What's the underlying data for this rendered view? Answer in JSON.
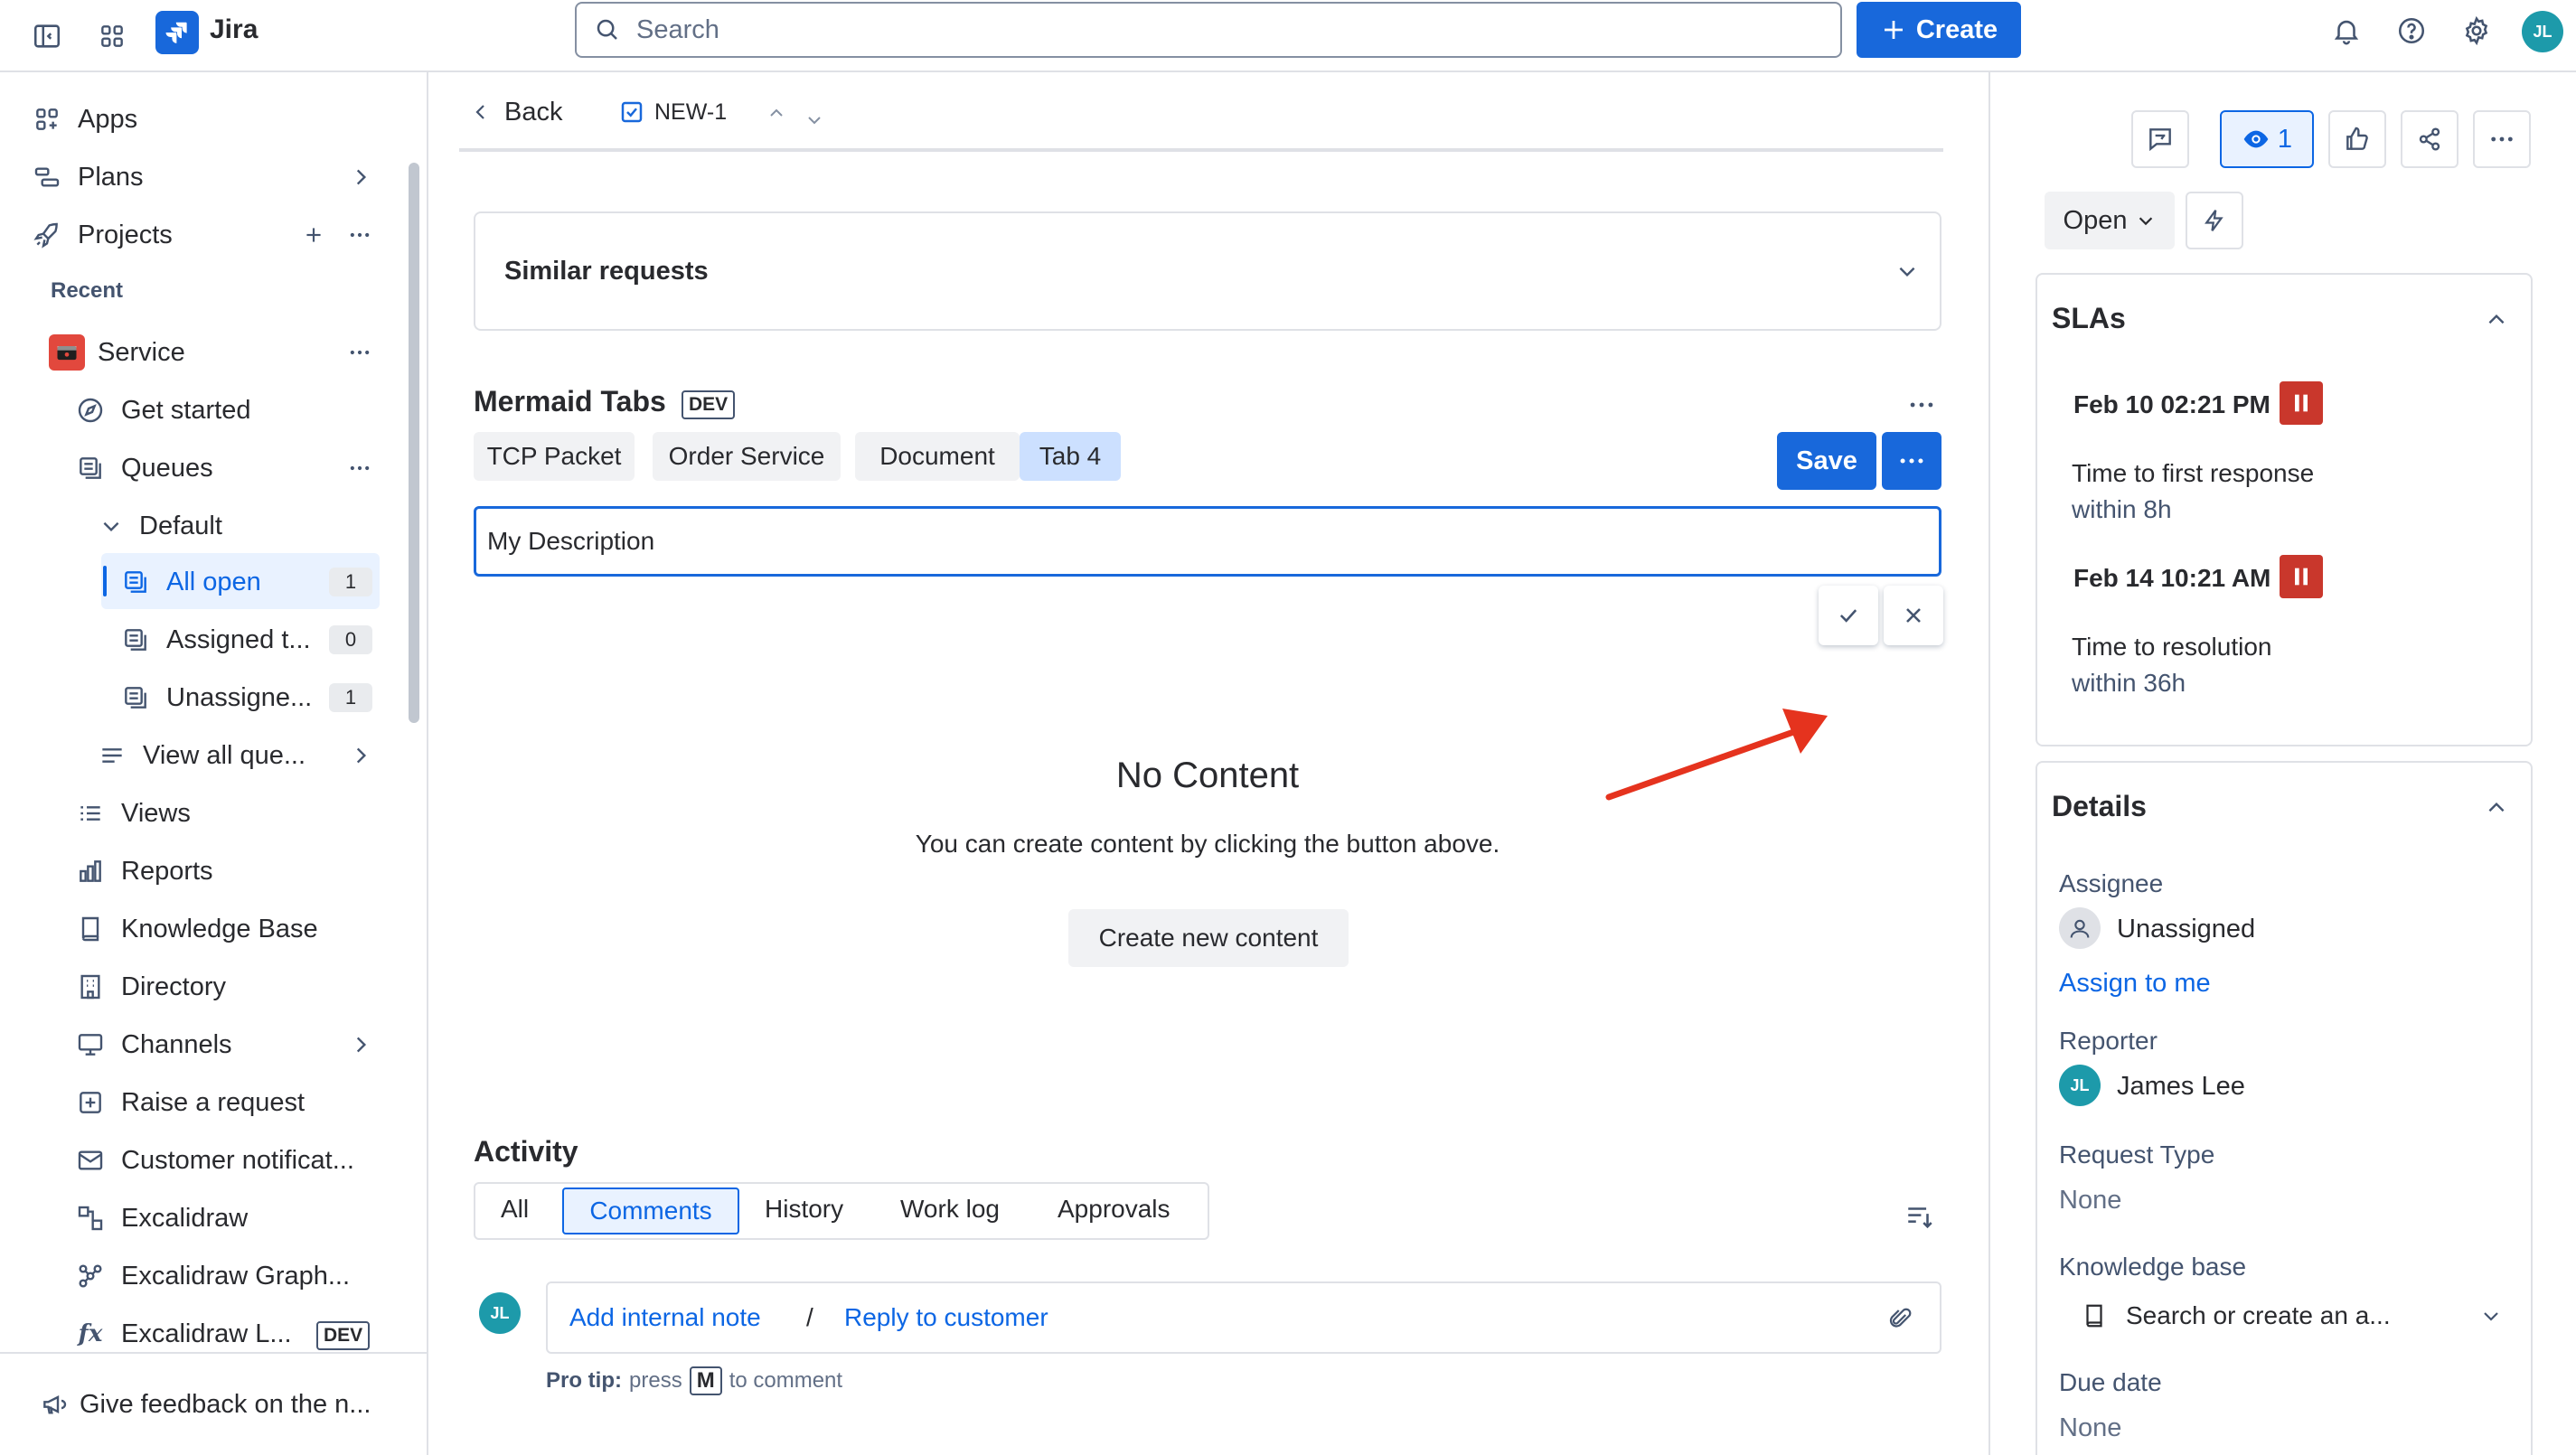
{
  "topbar": {
    "app_name": "Jira",
    "search_placeholder": "Search",
    "create_label": "Create",
    "avatar_initials": "JL"
  },
  "sidebar": {
    "apps": "Apps",
    "plans": "Plans",
    "projects": "Projects",
    "recent": "Recent",
    "service": "Service",
    "get_started": "Get started",
    "queues": "Queues",
    "default": "Default",
    "all_open": "All open",
    "all_open_count": "1",
    "assigned": "Assigned t...",
    "assigned_count": "0",
    "unassigned": "Unassigne...",
    "unassigned_count": "1",
    "view_all_queues": "View all que...",
    "views": "Views",
    "reports": "Reports",
    "knowledge_base": "Knowledge Base",
    "directory": "Directory",
    "channels": "Channels",
    "raise_request": "Raise a request",
    "customer_notifications": "Customer notificat...",
    "excalidraw": "Excalidraw",
    "excalidraw_graph": "Excalidraw Graph...",
    "excalidraw_l": "Excalidraw L...",
    "dev_badge": "DEV",
    "feedback": "Give feedback on the n..."
  },
  "issue": {
    "back_label": "Back",
    "issue_key": "NEW-1",
    "similar_requests": "Similar requests",
    "mermaid_title": "Mermaid Tabs",
    "dev_badge": "DEV",
    "tabs": [
      "TCP Packet",
      "Order Service",
      "Document",
      "Tab 4"
    ],
    "save_label": "Save",
    "description_value": "My Description",
    "no_content_title": "No Content",
    "no_content_text": "You can create content by clicking the button above.",
    "create_content_label": "Create new content"
  },
  "activity": {
    "title": "Activity",
    "tabs": [
      "All",
      "Comments",
      "History",
      "Work log",
      "Approvals"
    ],
    "commenter_initials": "JL",
    "add_internal_note": "Add internal note",
    "separator": "/",
    "reply_to_customer": "Reply to customer",
    "pro_tip_label": "Pro tip:",
    "pro_tip_press": "press",
    "pro_tip_key": "M",
    "pro_tip_rest": "to comment"
  },
  "right_panel": {
    "watchers_count": "1",
    "status": "Open",
    "slas_title": "SLAs",
    "sla1_time": "Feb 10 02:21 PM",
    "sla1_label": "Time to first response",
    "sla1_within": "within 8h",
    "sla2_time": "Feb 14 10:21 AM",
    "sla2_label": "Time to resolution",
    "sla2_within": "within 36h",
    "details_title": "Details",
    "assignee_label": "Assignee",
    "assignee_value": "Unassigned",
    "assign_to_me": "Assign to me",
    "reporter_label": "Reporter",
    "reporter_initials": "JL",
    "reporter_value": "James Lee",
    "request_type_label": "Request Type",
    "request_type_value": "None",
    "knowledge_base_label": "Knowledge base",
    "knowledge_base_placeholder": "Search or create an a...",
    "due_date_label": "Due date",
    "due_date_value": "None"
  },
  "colors": {
    "brand_blue": "#0c66e4",
    "link_blue": "#0c66e4",
    "sla_red": "#c9372c",
    "annotation_red": "#e5331e",
    "avatar_teal": "#1d9aaa"
  }
}
